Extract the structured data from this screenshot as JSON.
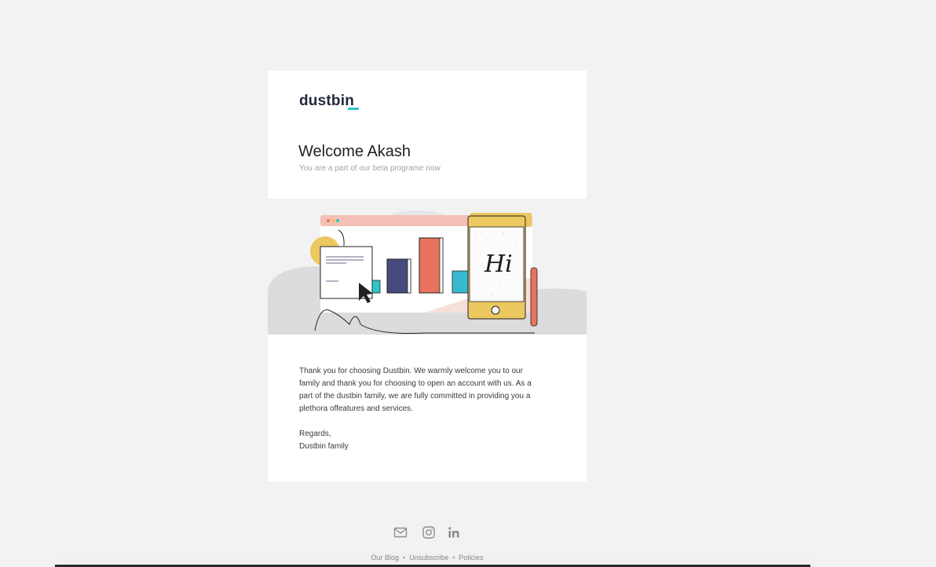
{
  "email": {
    "logo_text": "dustbin",
    "title": "Welcome Akash",
    "subtitle": "You are a part of our beta programe now",
    "hero": {
      "phone_text": "Hi"
    },
    "body": "Thank you for choosing Dustbin. We warmly welcome you to our family and thank you for choosing to open an account with us. As a part of the dustbin family, we are fully committed in providing you a plethora offeatures and services.",
    "regards": "Regards,",
    "signoff": "Dustbin family"
  },
  "footer": {
    "social": [
      {
        "icon": "mail-icon"
      },
      {
        "icon": "instagram-icon"
      },
      {
        "icon": "linkedin-icon"
      }
    ],
    "links": [
      "Our Blog",
      "Unsubscribe",
      "Policies"
    ],
    "separator": "•"
  },
  "colors": {
    "background": "#f2f2f2",
    "card": "#ffffff",
    "logo_accent": "#2ec4c9",
    "text_dark": "#1f1f24",
    "text_muted": "#a3a3a3"
  }
}
